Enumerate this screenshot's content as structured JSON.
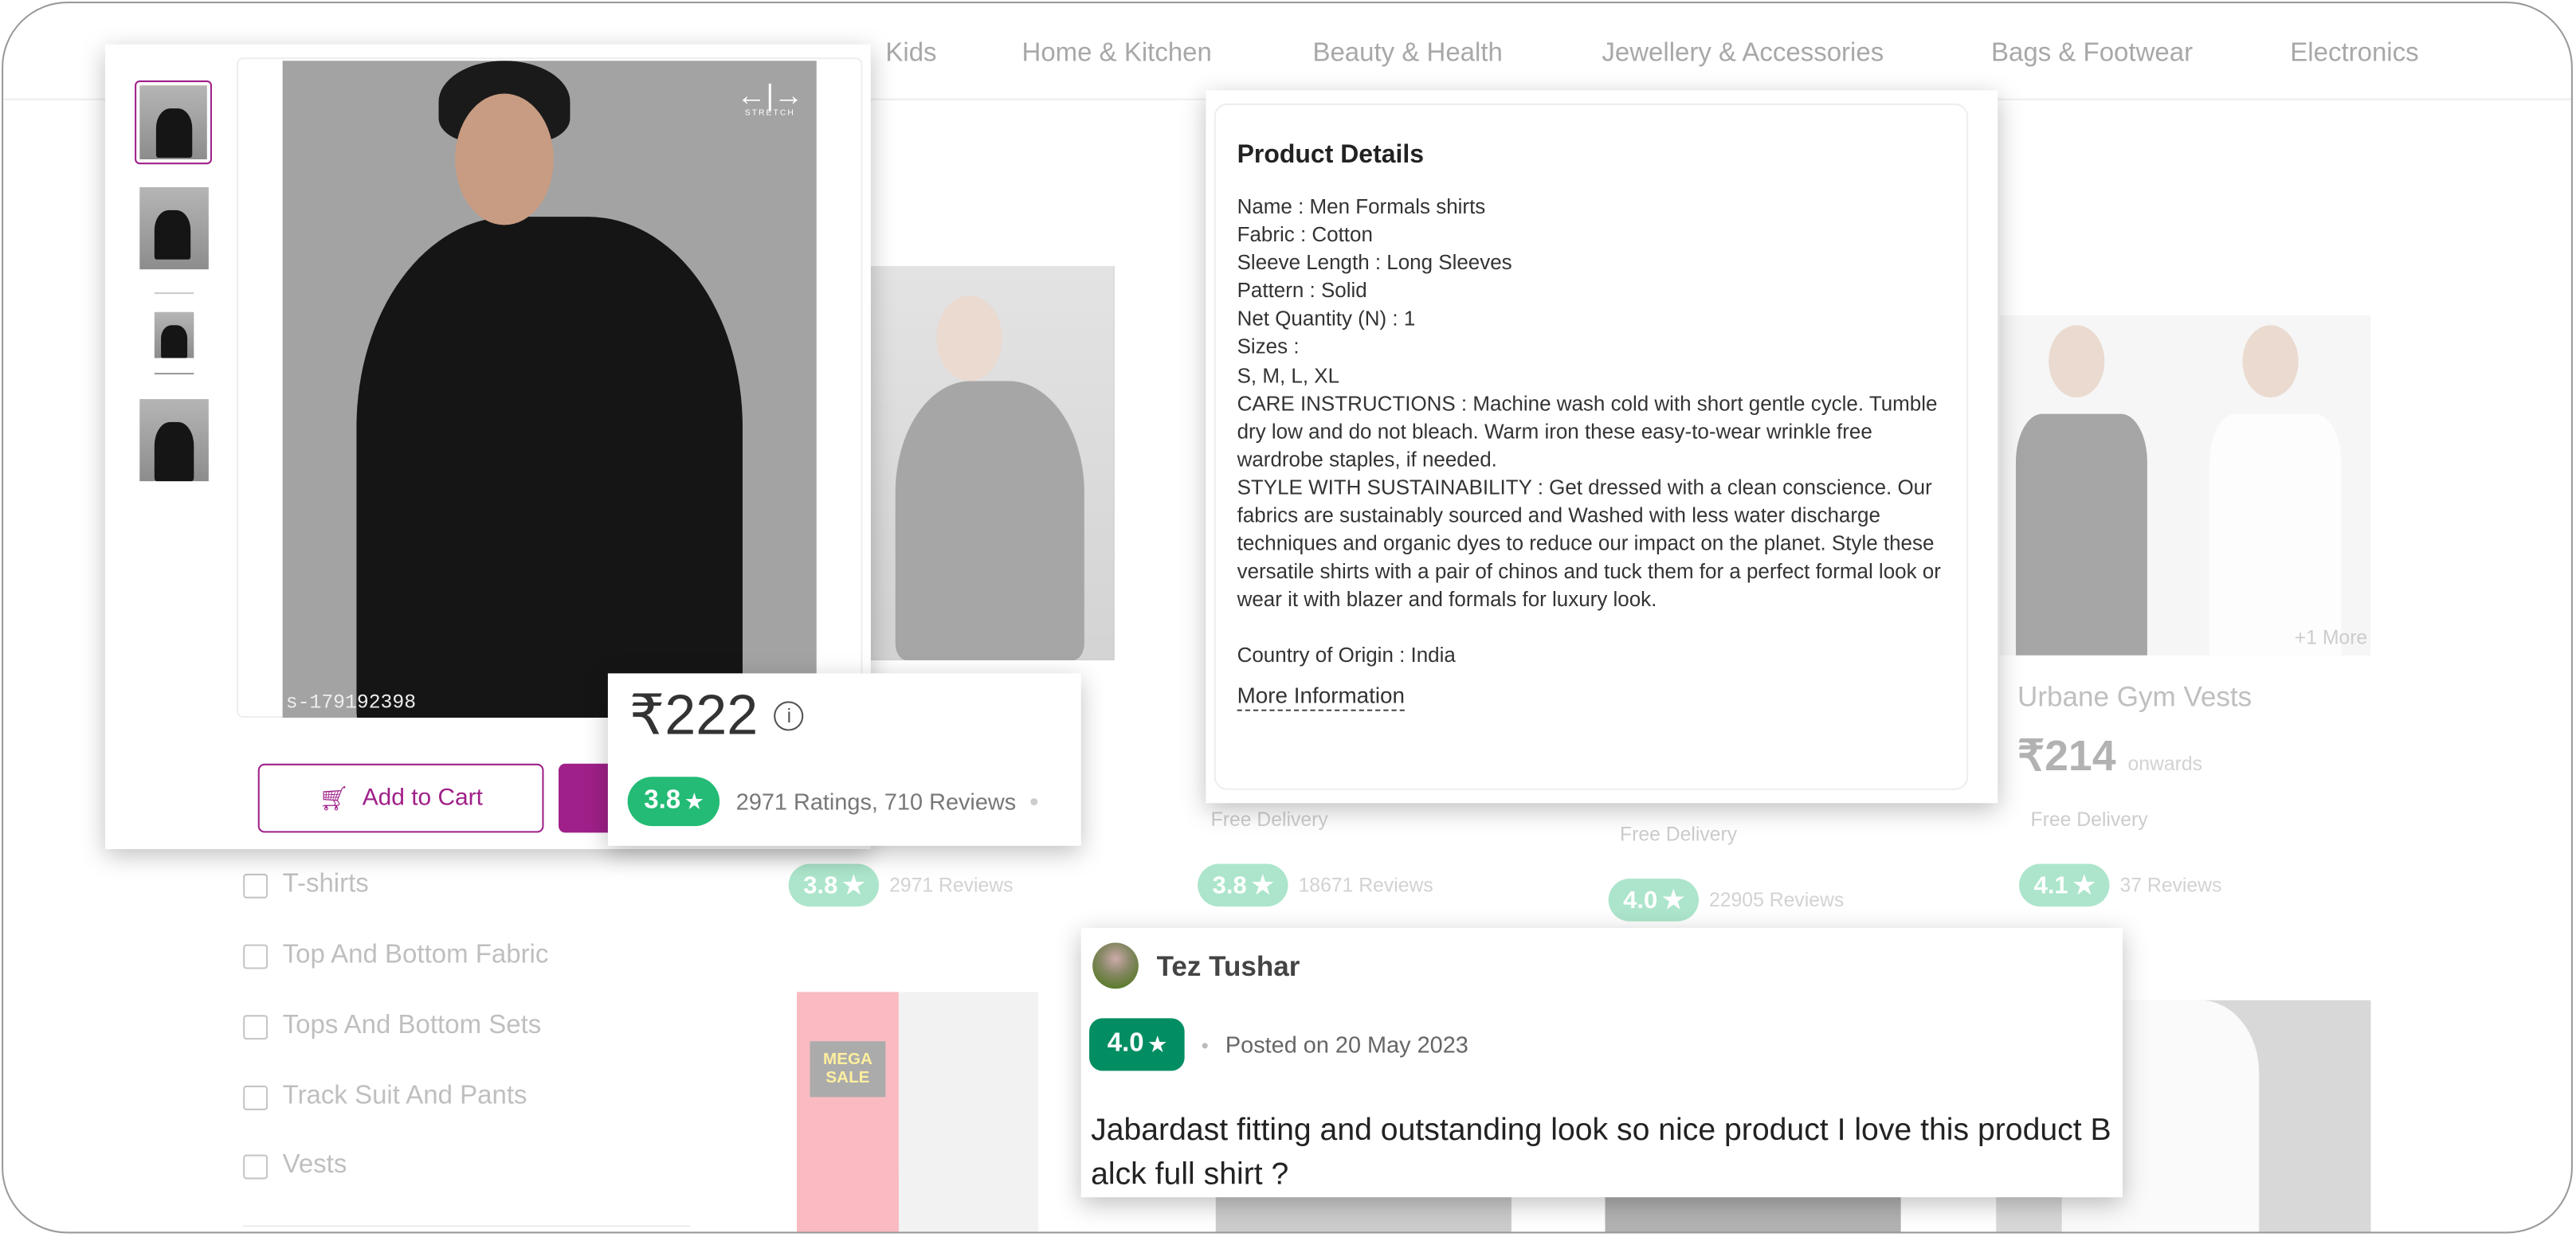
{
  "nav": {
    "items": [
      "Kids",
      "Home & Kitchen",
      "Beauty & Health",
      "Jewellery & Accessories",
      "Bags & Footwear",
      "Electronics"
    ]
  },
  "sidebar": {
    "filters": [
      "T-shirts",
      "Top And Bottom Fabric",
      "Tops And Bottom Sets",
      "Track Suit And Pants",
      "Vests"
    ]
  },
  "cards": [
    {
      "rating": "3.8",
      "reviews": "2971 Reviews"
    },
    {
      "delivery": "Free Delivery",
      "rating": "3.8",
      "reviews": "18671 Reviews"
    },
    {
      "delivery": "Free Delivery",
      "rating": "4.0",
      "reviews": "22905 Reviews"
    },
    {
      "title": "Urbane Gym Vests",
      "price": "₹214",
      "price_suffix": "onwards",
      "delivery": "Free Delivery",
      "rating": "4.1",
      "reviews": "37 Reviews",
      "more": "+1 More"
    }
  ],
  "product": {
    "image_badge": "STRETCH",
    "sku": "s-179192398",
    "add_to_cart": "Add to Cart",
    "price": "₹222",
    "rating": "3.8",
    "ratings_text": "2971 Ratings, 710 Reviews"
  },
  "details": {
    "title": "Product Details",
    "lines": [
      "Name : Men Formals shirts",
      "Fabric : Cotton",
      "Sleeve Length : Long Sleeves",
      "Pattern : Solid",
      "Net Quantity (N) : 1",
      "Sizes :",
      "S, M, L, XL",
      "CARE INSTRUCTIONS : Machine wash cold with short gentle cycle. Tumble dry low and do not bleach. Warm iron these easy-to-wear wrinkle free wardrobe staples, if needed.",
      "STYLE WITH SUSTAINABILITY : Get dressed with a clean conscience. Our fabrics are sustainably sourced and Washed with less water discharge techniques and organic dyes to reduce our impact on the planet. Style these versatile shirts with a pair of chinos and tuck them for a perfect formal look or wear it with blazer and formals for luxury look."
    ],
    "origin": "Country of Origin : India",
    "more": "More Information"
  },
  "review": {
    "name": "Tez Tushar",
    "rating": "4.0",
    "posted": "Posted on 20 May 2023",
    "text": "Jabardast fitting and outstanding look so nice product I love this product Balck full shirt ?"
  },
  "colors": {
    "accent": "#9f2089",
    "rating_green": "#23bb75",
    "review_green": "#038d63"
  },
  "banner": {
    "text": "MEGA SALE"
  }
}
